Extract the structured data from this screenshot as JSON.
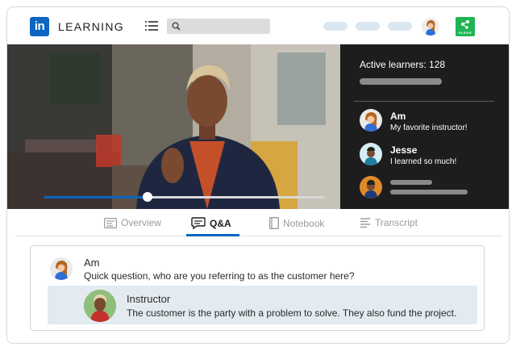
{
  "header": {
    "logo_text": "in",
    "brand": "LEARNING",
    "icons": {
      "menu": "hamburger-menu-icon",
      "search": "search-icon",
      "plexis": "plexis-logo"
    },
    "accent_color": "#0a66c2"
  },
  "video": {
    "progress": 0.37,
    "colors": {
      "fill": "#0a66c2",
      "track": "#d8d8d8"
    }
  },
  "chat": {
    "active_learners": "Active learners: 128",
    "messages": [
      {
        "name": "Am",
        "text": "My favorite instructor!"
      },
      {
        "name": "Jesse",
        "text": "I learned so much!"
      },
      {
        "name": "",
        "text": ""
      }
    ],
    "background": "#1d1d1d"
  },
  "tabs": [
    {
      "label": "Overview",
      "icon": "overview-icon",
      "active": false
    },
    {
      "label": "Q&A",
      "icon": "chat-bubble-icon",
      "active": true
    },
    {
      "label": "Notebook",
      "icon": "notebook-icon",
      "active": false
    },
    {
      "label": "Transcript",
      "icon": "transcript-icon",
      "active": false
    }
  ],
  "qa": {
    "question": {
      "name": "Am",
      "text": "Quick question, who are you referring to as the customer here?"
    },
    "answer": {
      "name": "Instructor",
      "text": "The customer is the party with a problem to solve. They also fund the project."
    }
  }
}
